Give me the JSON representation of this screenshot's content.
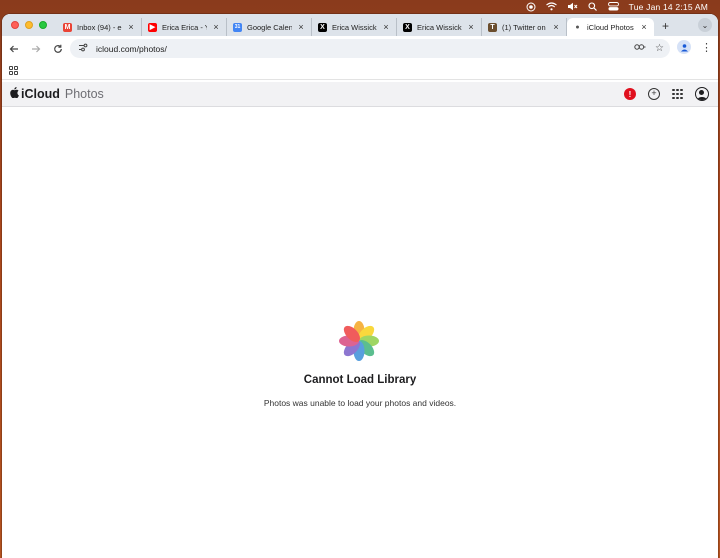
{
  "menubar": {
    "clock": "Tue Jan 14  2:15 AM"
  },
  "window": {
    "tabs": [
      {
        "title": "Inbox (94) - e",
        "favicon": "gmail-icon",
        "color": "#ea4335",
        "glyph": "M"
      },
      {
        "title": "Erica Erica - Y",
        "favicon": "youtube-icon",
        "color": "#ff0000",
        "glyph": "▶"
      },
      {
        "title": "Google Calend",
        "favicon": "calendar-icon",
        "color": "#4285f4",
        "glyph": "31"
      },
      {
        "title": "Erica Wissick",
        "favicon": "x-icon",
        "color": "#000000",
        "glyph": "X"
      },
      {
        "title": "Erica Wissick",
        "favicon": "x-icon",
        "color": "#000000",
        "glyph": "X"
      },
      {
        "title": "(1) Twitter on",
        "favicon": "twitter-icon",
        "color": "#6b4e2e",
        "glyph": "T"
      },
      {
        "title": "iCloud Photos",
        "favicon": "apple-icon",
        "color": "#555555",
        "glyph": ""
      }
    ],
    "url": "icloud.com/photos/"
  },
  "icloud": {
    "brand_name": "iCloud",
    "app_name": "Photos",
    "alert_glyph": "!"
  },
  "message": {
    "title": "Cannot Load Library",
    "body": "Photos was unable to load your photos and videos."
  },
  "colors": {
    "accent_alert": "#e0101e",
    "wallpaper": "#a8461c"
  }
}
